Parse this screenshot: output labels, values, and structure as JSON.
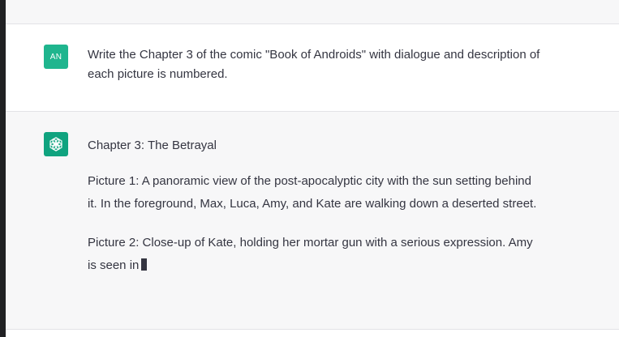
{
  "conversation": {
    "user": {
      "avatar_initials": "AN",
      "message": "Write the Chapter 3 of the comic \"Book of Androids\" with dialogue and description of each picture is numbered."
    },
    "assistant": {
      "avatar_icon": "openai-logo-icon",
      "title": "Chapter 3: The Betrayal",
      "paragraphs": [
        "Picture 1: A panoramic view of the post-apocalyptic city with the sun setting behind it. In the foreground, Max, Luca, Amy, and Kate are walking down a deserted street.",
        "Picture 2: Close-up of Kate, holding her mortar gun with a serious expression. Amy is seen in"
      ],
      "streaming": true
    }
  },
  "colors": {
    "user_avatar": "#1fb58e",
    "assistant_avatar": "#10a37f",
    "text": "#343541",
    "user_row_bg": "#ffffff",
    "assistant_row_bg": "#f7f7f8"
  }
}
